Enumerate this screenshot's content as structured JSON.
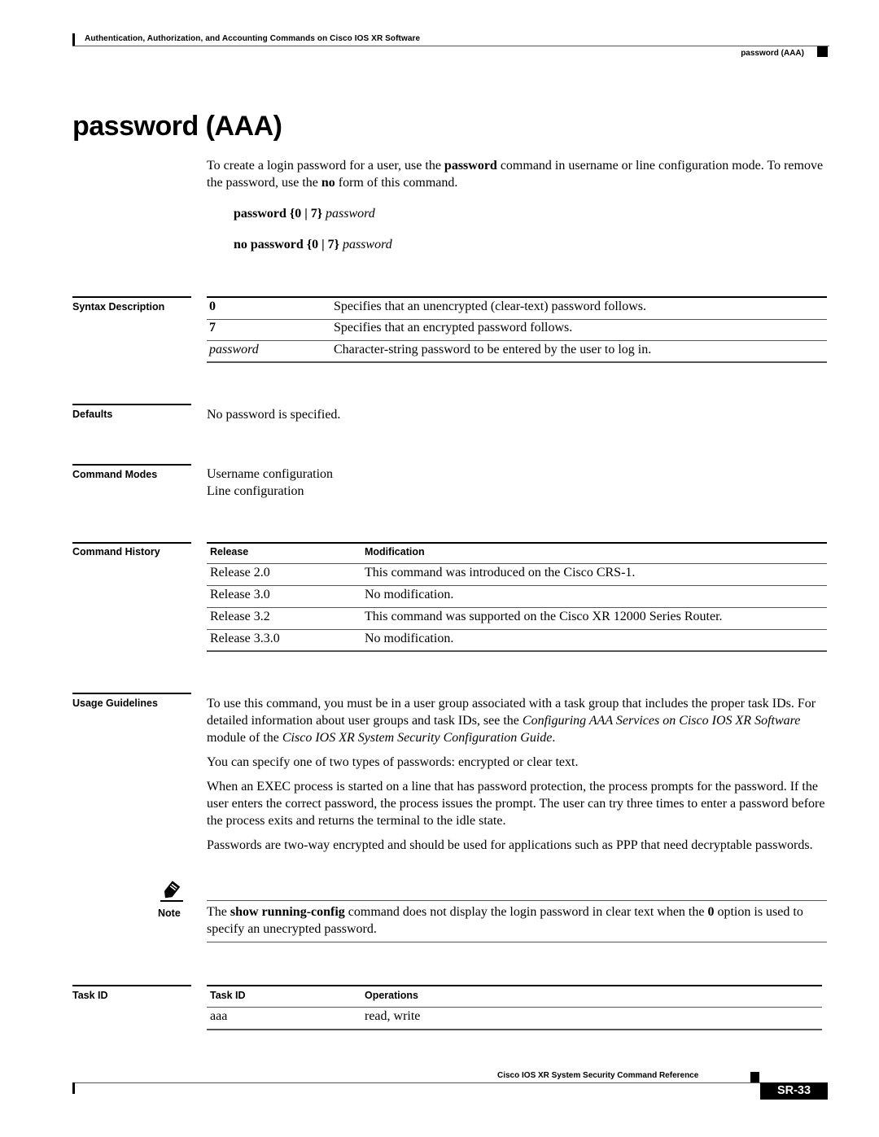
{
  "header": {
    "chapter_title": "Authentication, Authorization, and Accounting Commands on Cisco IOS XR Software",
    "running_title": "password (AAA)"
  },
  "page_title": "password (AAA)",
  "intro": {
    "part1": "To create a login password for a user, use the ",
    "cmd1": "password",
    "part2": " command in username or line configuration mode. To remove the password, use the ",
    "cmd2": "no",
    "part3": " form of this command."
  },
  "syntax": {
    "line1": {
      "cmd": "password",
      "args": "{0 | 7}",
      "param": "password"
    },
    "line2": {
      "cmd": "no password",
      "args": "{0 | 7}",
      "param": "password"
    }
  },
  "syntax_description": {
    "label": "Syntax Description",
    "rows": [
      {
        "term": "0",
        "style": "bold",
        "desc": "Specifies that an unencrypted (clear-text) password follows."
      },
      {
        "term": "7",
        "style": "bold",
        "desc": "Specifies that an encrypted password follows."
      },
      {
        "term": "password",
        "style": "italic",
        "desc": "Character-string password to be entered by the user to log in."
      }
    ]
  },
  "defaults": {
    "label": "Defaults",
    "text": "No password is specified."
  },
  "command_modes": {
    "label": "Command Modes",
    "lines": [
      "Username configuration",
      "Line configuration"
    ]
  },
  "command_history": {
    "label": "Command History",
    "headers": [
      "Release",
      "Modification"
    ],
    "rows": [
      {
        "release": "Release 2.0",
        "modification": "This command was introduced on the Cisco CRS-1."
      },
      {
        "release": "Release 3.0",
        "modification": "No modification."
      },
      {
        "release": "Release 3.2",
        "modification": "This command was supported on the Cisco XR 12000 Series Router."
      },
      {
        "release": "Release 3.3.0",
        "modification": "No modification."
      }
    ]
  },
  "usage_guidelines": {
    "label": "Usage Guidelines",
    "p1": {
      "a": "To use this command, you must be in a user group associated with a task group that includes the proper task IDs. For detailed information about user groups and task IDs, see the ",
      "i1": "Configuring AAA Services on Cisco IOS XR Software",
      "b": " module of the ",
      "i2": "Cisco IOS XR System Security Configuration Guide",
      "c": "."
    },
    "p2": "You can specify one of two types of passwords: encrypted or clear text.",
    "p3": "When an EXEC process is started on a line that has password protection, the process prompts for the password. If the user enters the correct password, the process issues the prompt. The user can try three times to enter a password before the process exits and returns the terminal to the idle state.",
    "p4": "Passwords are two-way encrypted and should be used for applications such as PPP that need decryptable passwords."
  },
  "note": {
    "label": "Note",
    "icon": "pencil-icon",
    "a": "The ",
    "b1": "show running-config",
    "b": " command does not display the login password in clear text when the ",
    "b2": "0",
    "c": " option is used to specify an unecrypted password."
  },
  "task_id": {
    "label": "Task ID",
    "headers": [
      "Task ID",
      "Operations"
    ],
    "rows": [
      {
        "task": "aaa",
        "operations": "read, write"
      }
    ]
  },
  "footer": {
    "book_title": "Cisco IOS XR System Security Command Reference",
    "page_number": "SR-33"
  }
}
